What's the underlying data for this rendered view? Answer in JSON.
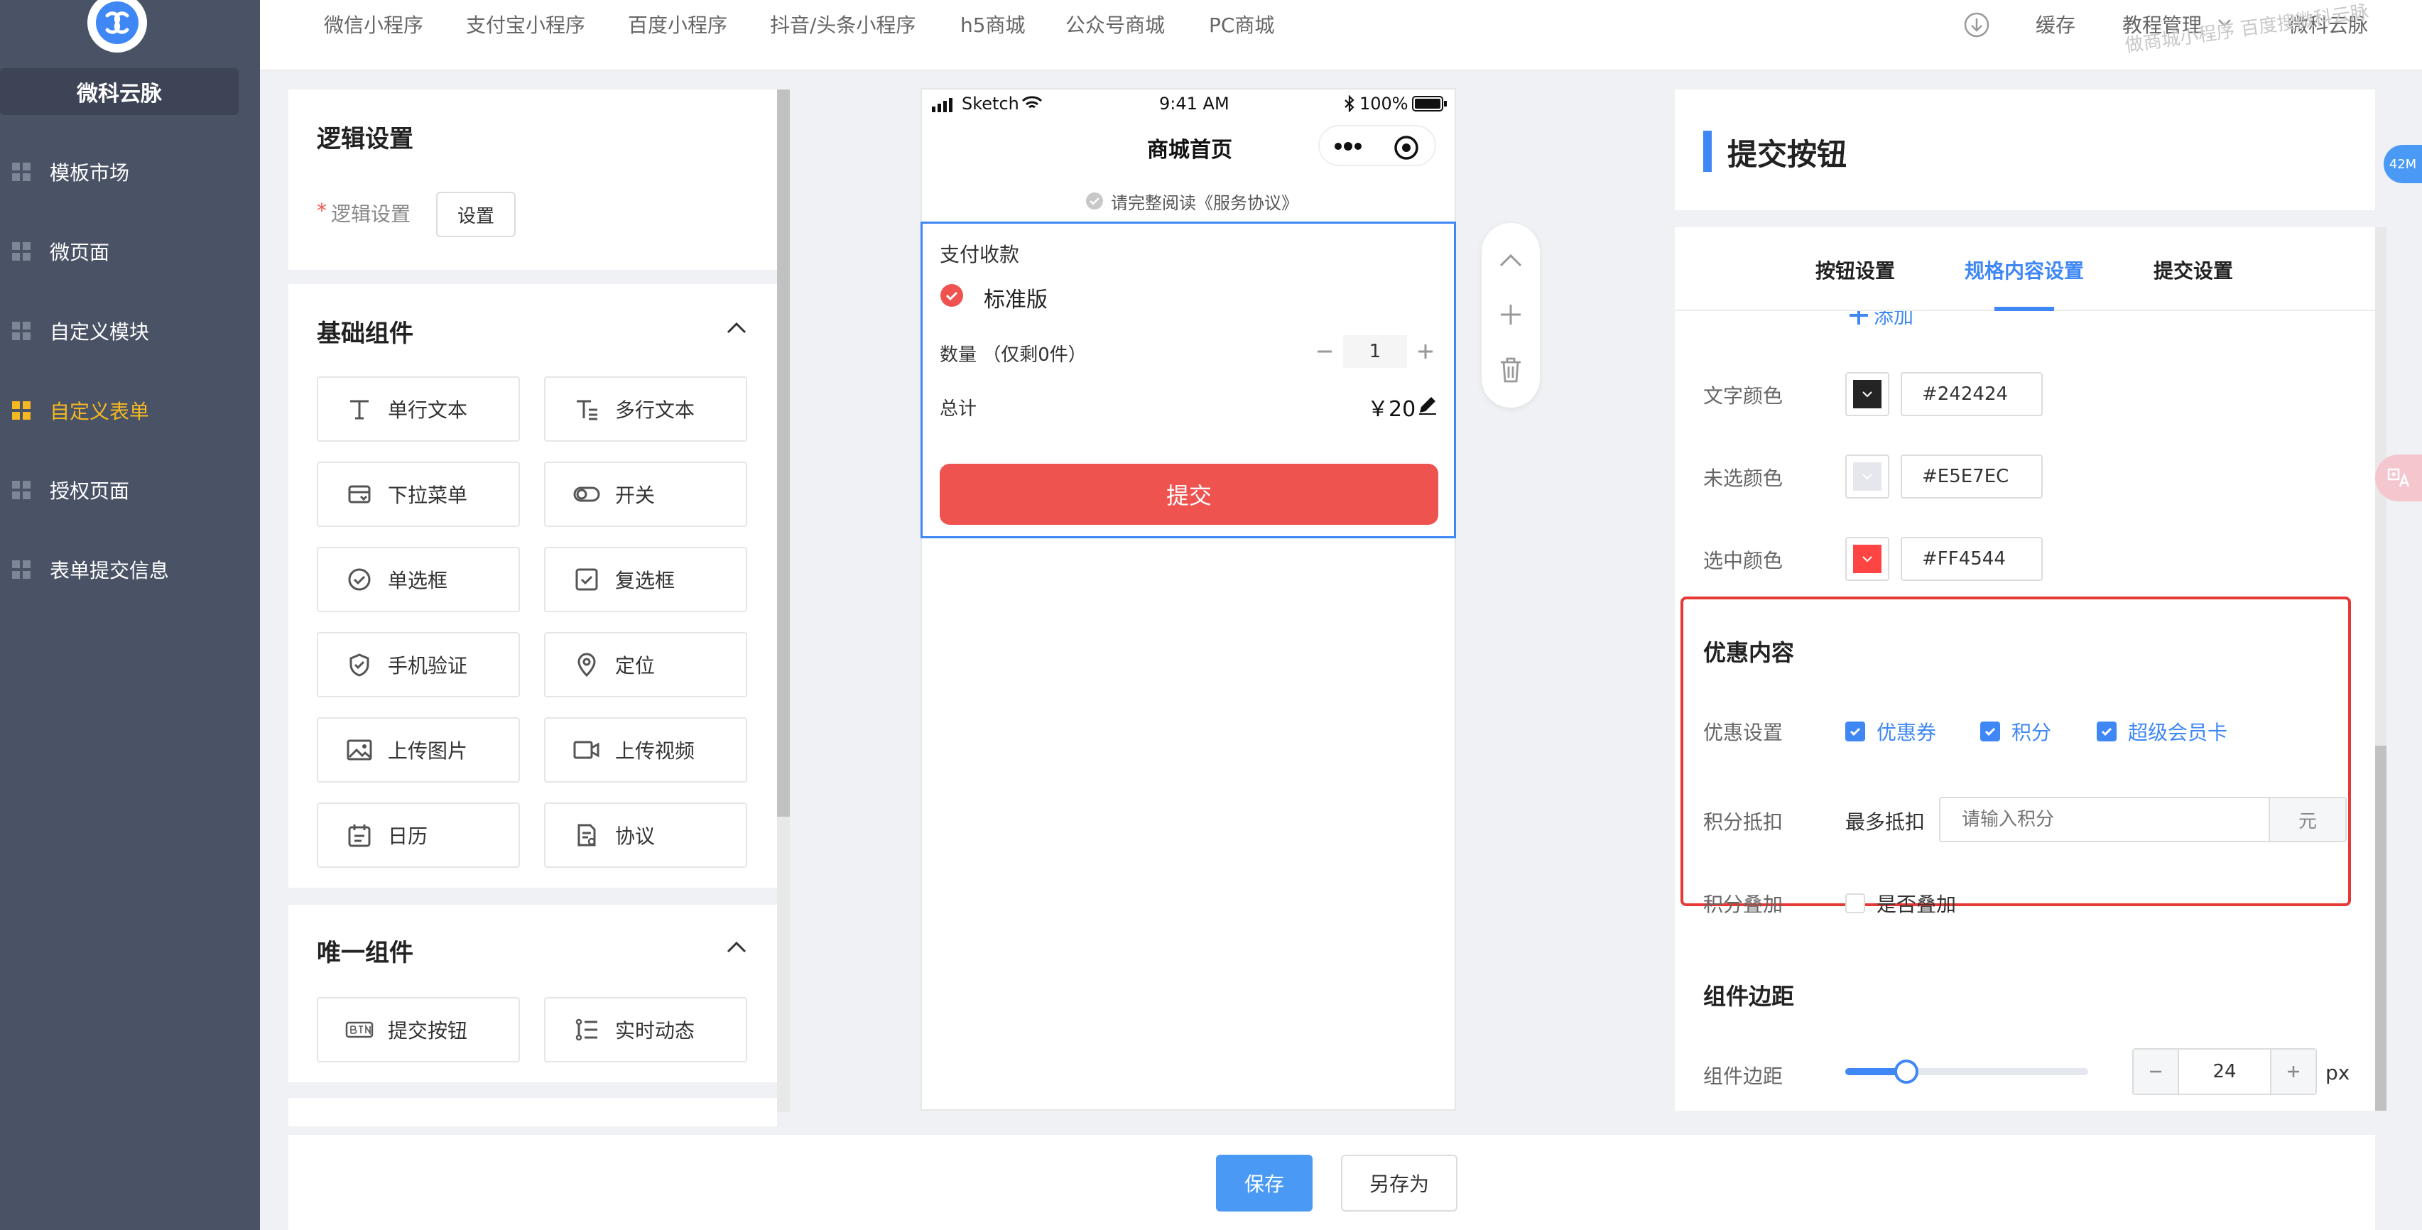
{
  "sidebar": {
    "brand": "微科云脉",
    "items": [
      {
        "label": "模板市场"
      },
      {
        "label": "微页面"
      },
      {
        "label": "自定义模块"
      },
      {
        "label": "自定义表单"
      },
      {
        "label": "授权页面"
      },
      {
        "label": "表单提交信息"
      }
    ],
    "active_index": 3
  },
  "topbar": {
    "tabs": [
      "微信小程序",
      "支付宝小程序",
      "百度小程序",
      "抖音/头条小程序",
      "h5商城",
      "公众号商城",
      "PC商城"
    ],
    "cache": "缓存",
    "tutorial": "教程管理",
    "user": "微科云脉",
    "watermark": "做商城小程序  百度搜微科云脉"
  },
  "logic": {
    "title": "逻辑设置",
    "required_mark": "*",
    "label": "逻辑设置",
    "button": "设置"
  },
  "basic": {
    "title": "基础组件",
    "items": [
      {
        "label": "单行文本",
        "icon": "single-line-text-icon"
      },
      {
        "label": "多行文本",
        "icon": "multi-line-text-icon"
      },
      {
        "label": "下拉菜单",
        "icon": "dropdown-icon"
      },
      {
        "label": "开关",
        "icon": "switch-icon"
      },
      {
        "label": "单选框",
        "icon": "radio-icon"
      },
      {
        "label": "复选框",
        "icon": "checkbox-icon"
      },
      {
        "label": "手机验证",
        "icon": "shield-icon"
      },
      {
        "label": "定位",
        "icon": "location-icon"
      },
      {
        "label": "上传图片",
        "icon": "image-icon"
      },
      {
        "label": "上传视频",
        "icon": "video-icon"
      },
      {
        "label": "日历",
        "icon": "calendar-icon"
      },
      {
        "label": "协议",
        "icon": "agreement-icon"
      }
    ]
  },
  "unique": {
    "title": "唯一组件",
    "items": [
      {
        "label": "提交按钮",
        "icon": "btn-icon"
      },
      {
        "label": "实时动态",
        "icon": "list-icon"
      }
    ]
  },
  "phone": {
    "status": {
      "carrier": "Sketch",
      "time": "9:41 AM",
      "battery": "100%"
    },
    "nav_title": "商城首页",
    "agreement": "请完整阅读《服务协议》",
    "pay_title": "支付收款",
    "option": "标准版",
    "qty_label": "数量 （仅剩0件）",
    "qty_value": "1",
    "total_label": "总计",
    "total_value": "￥20",
    "submit": "提交"
  },
  "right": {
    "title": "提交按钮",
    "tabs": [
      "按钮设置",
      "规格内容设置",
      "提交设置"
    ],
    "active_tab": 1,
    "add_label": "添加",
    "colors": [
      {
        "label": "文字颜色",
        "value": "#242424",
        "swatch": "#242424"
      },
      {
        "label": "未选颜色",
        "value": "#E5E7EC",
        "swatch": "#E5E7EC"
      },
      {
        "label": "选中颜色",
        "value": "#FF4544",
        "swatch": "#FF4544"
      }
    ],
    "discount": {
      "title": "优惠内容",
      "setting_label": "优惠设置",
      "options": [
        "优惠券",
        "积分",
        "超级会员卡"
      ],
      "points_label": "积分抵扣",
      "max_label": "最多抵扣",
      "points_placeholder": "请输入积分",
      "unit": "元",
      "stack_label": "积分叠加",
      "stack_option": "是否叠加"
    },
    "margin": {
      "title": "组件边距",
      "label": "组件边距",
      "value": "24",
      "unit": "px",
      "level": 0.25
    }
  },
  "footer": {
    "save": "保存",
    "save_as": "另存为"
  },
  "badges": {
    "memory": "42M"
  },
  "colors": {
    "accent": "#3e87f5",
    "sidebar": "#4a5366",
    "active": "#f5b822",
    "danger": "#ef5350",
    "highlight": "#e53935"
  }
}
